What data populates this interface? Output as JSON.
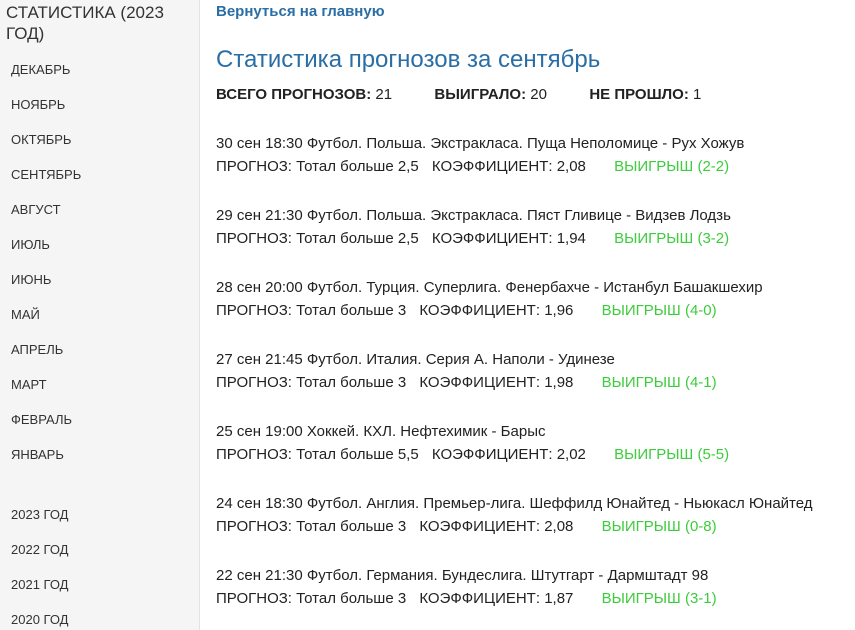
{
  "sidebar": {
    "title": "СТАТИСТИКА (2023 ГОД)",
    "months": [
      "ДЕКАБРЬ",
      "НОЯБРЬ",
      "ОКТЯБРЬ",
      "СЕНТЯБРЬ",
      "АВГУСТ",
      "ИЮЛЬ",
      "ИЮНЬ",
      "МАЙ",
      "АПРЕЛЬ",
      "МАРТ",
      "ФЕВРАЛЬ",
      "ЯНВАРЬ"
    ],
    "years": [
      "2023 ГОД",
      "2022 ГОД",
      "2021 ГОД",
      "2020 ГОД"
    ]
  },
  "main": {
    "back_link": "Вернуться на главную",
    "title": "Статистика прогнозов за сентябрь",
    "summary": {
      "total_label": "ВСЕГО ПРОГНОЗОВ:",
      "total_value": "21",
      "won_label": "ВЫИГРАЛО:",
      "won_value": "20",
      "lost_label": "НЕ ПРОШЛО:",
      "lost_value": "1"
    },
    "forecast_label": "ПРОГНОЗ:",
    "coef_label": "КОЭФФИЦИЕНТ:",
    "forecasts": [
      {
        "event": "30 сен 18:30 Футбол. Польша. Экстракласа. Пуща Неполомице - Рух Хожув",
        "prediction": "Тотал больше 2,5",
        "coef": "2,08",
        "result": "ВЫИГРЫШ (2-2)"
      },
      {
        "event": "29 сен 21:30 Футбол. Польша. Экстракласа. Пяст Гливице - Видзев Лодзь",
        "prediction": "Тотал больше 2,5",
        "coef": "1,94",
        "result": "ВЫИГРЫШ (3-2)"
      },
      {
        "event": "28 сен 20:00 Футбол. Турция. Суперлига. Фенербахче - Истанбул Башакшехир",
        "prediction": "Тотал больше 3",
        "coef": "1,96",
        "result": "ВЫИГРЫШ (4-0)"
      },
      {
        "event": "27 сен 21:45 Футбол. Италия. Серия А. Наполи - Удинезе",
        "prediction": "Тотал больше 3",
        "coef": "1,98",
        "result": "ВЫИГРЫШ (4-1)"
      },
      {
        "event": "25 сен 19:00 Хоккей. КХЛ. Нефтехимик - Барыс",
        "prediction": "Тотал больше 5,5",
        "coef": "2,02",
        "result": "ВЫИГРЫШ (5-5)"
      },
      {
        "event": "24 сен 18:30 Футбол. Англия. Премьер-лига. Шеффилд Юнайтед - Ньюкасл Юнайтед",
        "prediction": "Тотал больше 3",
        "coef": "2,08",
        "result": "ВЫИГРЫШ (0-8)"
      },
      {
        "event": "22 сен 21:30 Футбол. Германия. Бундеслига. Штутгарт - Дармштадт 98",
        "prediction": "Тотал больше 3",
        "coef": "1,87",
        "result": "ВЫИГРЫШ (3-1)"
      }
    ]
  },
  "colors": {
    "link": "#2a6ea6",
    "win": "#3ccc3c",
    "sidebar_bg": "#f5f5f5"
  }
}
